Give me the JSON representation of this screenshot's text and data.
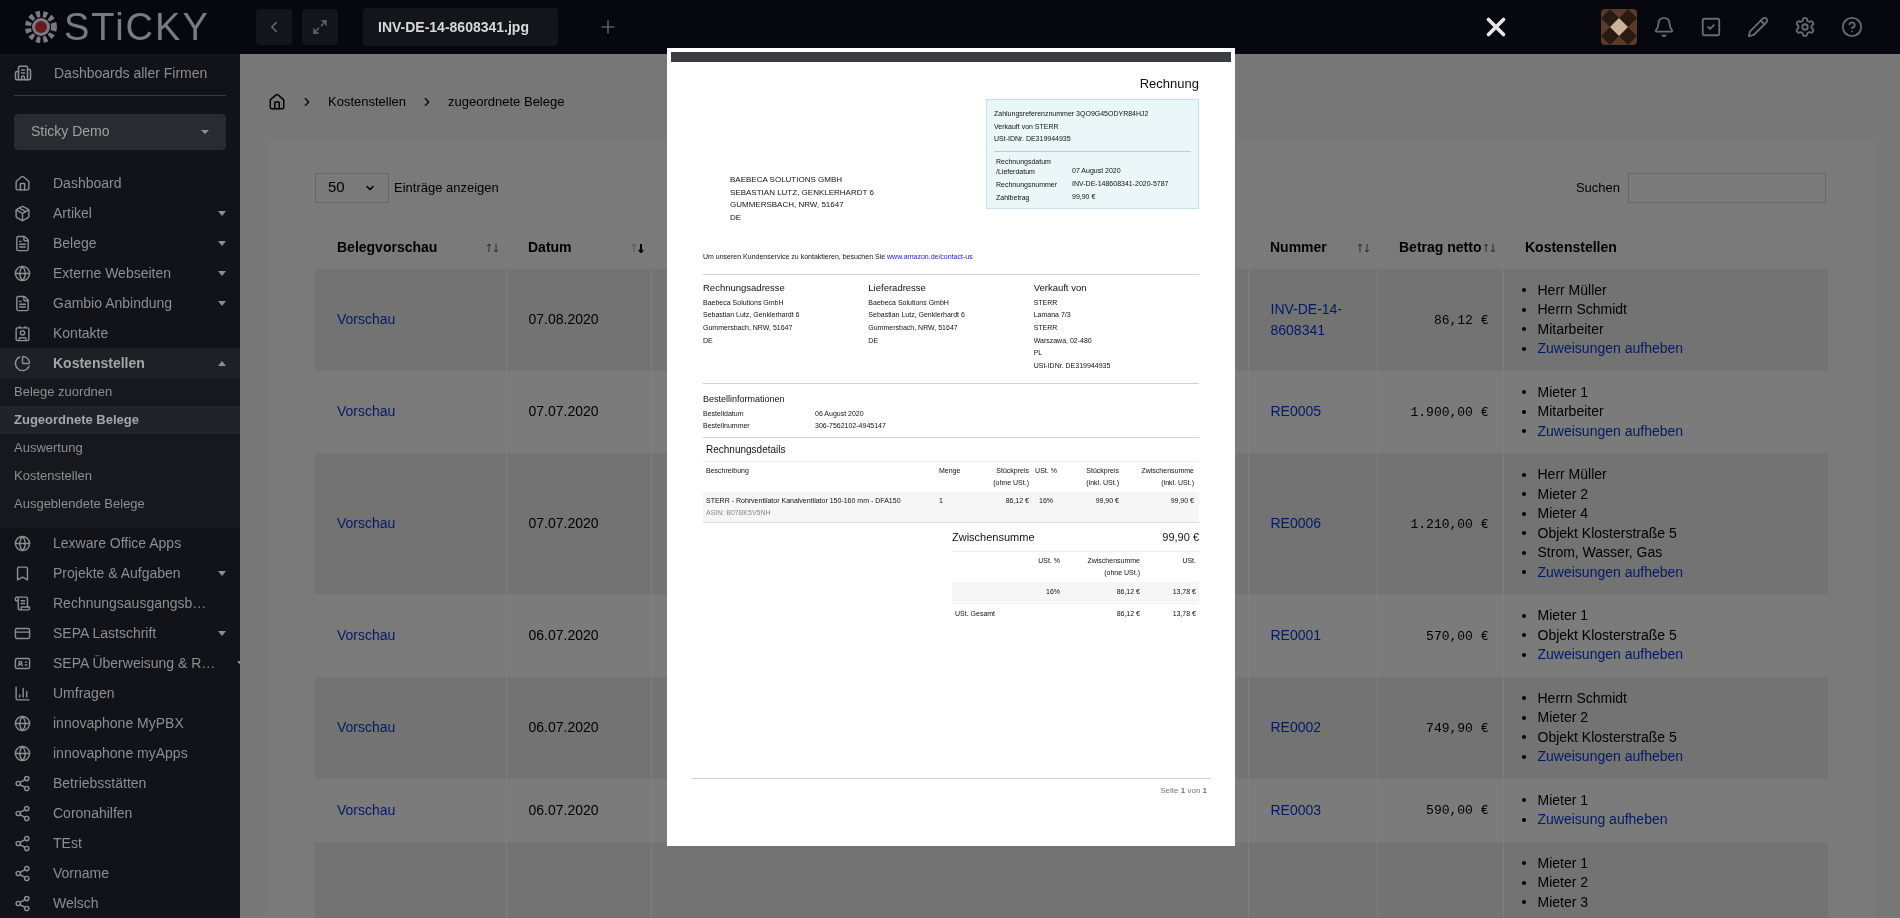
{
  "top_bar": {
    "logo": "STiCKY",
    "file_tab": "INV-DE-14-8608341.jpg"
  },
  "sidebar": {
    "top_link": "Dashboards aller Firmen",
    "company_select": "Sticky Demo",
    "items": [
      {
        "label": "Dashboard",
        "expandable": false,
        "expanded": false,
        "selected": false
      },
      {
        "label": "Artikel",
        "expandable": true,
        "expanded": false,
        "selected": false
      },
      {
        "label": "Belege",
        "expandable": true,
        "expanded": false,
        "selected": false
      },
      {
        "label": "Externe Webseiten",
        "expandable": true,
        "expanded": false,
        "selected": false
      },
      {
        "label": "Gambio Anbindung",
        "expandable": true,
        "expanded": false,
        "selected": false
      },
      {
        "label": "Kontakte",
        "expandable": false,
        "expanded": false,
        "selected": false
      },
      {
        "label": "Kostenstellen",
        "expandable": true,
        "expanded": true,
        "selected": true,
        "children": [
          {
            "label": "Belege zuordnen",
            "selected": false
          },
          {
            "label": "Zugeordnete Belege",
            "selected": true
          },
          {
            "label": "Auswertung",
            "selected": false
          },
          {
            "label": "Kostenstellen",
            "selected": false
          },
          {
            "label": "Ausgeblendete Belege",
            "selected": false
          }
        ]
      },
      {
        "label": "Lexware Office Apps",
        "expandable": false,
        "expanded": false,
        "selected": false
      },
      {
        "label": "Projekte & Aufgaben",
        "expandable": true,
        "expanded": false,
        "selected": false
      },
      {
        "label": "Rechnungsausgangsb…",
        "expandable": false,
        "expanded": false,
        "selected": false
      },
      {
        "label": "SEPA Lastschrift",
        "expandable": true,
        "expanded": false,
        "selected": false
      },
      {
        "label": "SEPA Überweisung & R…",
        "expandable": true,
        "expanded": false,
        "selected": false
      },
      {
        "label": "Umfragen",
        "expandable": false,
        "expanded": false,
        "selected": false
      },
      {
        "label": "innovaphone MyPBX",
        "expandable": false,
        "expanded": false,
        "selected": false
      },
      {
        "label": "innovaphone myApps",
        "expandable": false,
        "expanded": false,
        "selected": false
      },
      {
        "label": "Betriebsstätten",
        "expandable": false,
        "expanded": false,
        "selected": false
      },
      {
        "label": "Coronahilfen",
        "expandable": false,
        "expanded": false,
        "selected": false
      },
      {
        "label": "TEst",
        "expandable": false,
        "expanded": false,
        "selected": false
      },
      {
        "label": "Vorname",
        "expandable": false,
        "expanded": false,
        "selected": false
      },
      {
        "label": "Welsch",
        "expandable": false,
        "expanded": false,
        "selected": false
      }
    ]
  },
  "breadcrumb": [
    "Kostenstellen",
    "zugeordnete Belege"
  ],
  "table_controls": {
    "page_size": "50",
    "page_size_label": "Einträge anzeigen",
    "search_label": "Suchen"
  },
  "table": {
    "columns": [
      {
        "label": "Belegvorschau",
        "sortable": true,
        "sorted_desc": false
      },
      {
        "label": "Datum",
        "sortable": true,
        "sorted_desc": true
      },
      {
        "label": "Nummer",
        "sortable": true,
        "sorted_desc": false
      },
      {
        "label": "Betrag netto",
        "sortable": true,
        "sorted_desc": false
      },
      {
        "label": "Kostenstellen",
        "sortable": false
      }
    ],
    "rows": [
      {
        "preview": "Vorschau",
        "date": "07.08.2020",
        "number": "INV-DE-14-8608341",
        "amount": "86,12 €",
        "cost_centers": [
          "Herr Müller",
          "Herrn Schmidt",
          "Mitarbeiter"
        ],
        "action": "Zuweisungen aufheben"
      },
      {
        "preview": "Vorschau",
        "date": "07.07.2020",
        "number": "RE0005",
        "amount": "1.900,00 €",
        "cost_centers": [
          "Mieter 1",
          "Mitarbeiter"
        ],
        "action": "Zuweisungen aufheben"
      },
      {
        "preview": "Vorschau",
        "date": "07.07.2020",
        "number": "RE0006",
        "amount": "1.210,00 €",
        "cost_centers": [
          "Herr Müller",
          "Mieter 2",
          "Mieter 4",
          "Objekt Klosterstraße 5",
          "Strom, Wasser, Gas"
        ],
        "action": "Zuweisungen aufheben"
      },
      {
        "preview": "Vorschau",
        "date": "06.07.2020",
        "number": "RE0001",
        "amount": "570,00 €",
        "cost_centers": [
          "Mieter 1",
          "Objekt Klosterstraße 5"
        ],
        "action": "Zuweisungen aufheben"
      },
      {
        "preview": "Vorschau",
        "date": "06.07.2020",
        "number": "RE0002",
        "amount": "749,90 €",
        "cost_centers": [
          "Herrn Schmidt",
          "Mieter 2",
          "Objekt Klosterstraße 5"
        ],
        "action": "Zuweisungen aufheben"
      },
      {
        "preview": "Vorschau",
        "date": "06.07.2020",
        "number": "RE0003",
        "amount": "590,00 €",
        "cost_centers": [
          "Mieter 1"
        ],
        "action": "Zuweisung aufheben"
      },
      {
        "cost_centers": [
          "Mieter 1",
          "Mieter 2",
          "Mieter 3"
        ]
      }
    ]
  },
  "document": {
    "title": "Rechnung",
    "info_lines": [
      "Zahlungsreferenznummer 3QO9G45ODYR84HJ2",
      "Verkauft von STERR",
      "USt-IDNr. DE319944935"
    ],
    "info_fields": [
      {
        "label": "Rechnungsdatum /Lieferdatum",
        "value": "07 August 2020"
      },
      {
        "label": "Rechnungsnummer",
        "value": "INV-DE-148608341-2020-5787"
      },
      {
        "label": "Zahlbetrag",
        "value": "99,90 €"
      }
    ],
    "recipient": [
      "BAEBECA SOLUTIONS GMBH",
      "SEBASTIAN LUTZ, GENKLERHARDT 6",
      "GUMMERSBACH, NRW, 51647",
      "DE"
    ],
    "contact_text": "Um unseren Kundenservice zu kontaktieren, besuchen Sie",
    "contact_link": "www.amazon.de/contact-us",
    "addresses": [
      {
        "heading": "Rechnungsadresse",
        "lines": [
          "Baebeca Solutions GmbH",
          "Sebastian Lutz, Genklerhardt 6",
          "Gummersbach, NRW, 51647",
          "DE"
        ]
      },
      {
        "heading": "Lieferadresse",
        "lines": [
          "Baebeca Solutions GmbH",
          "Sebastian Lutz, Genklerhardt 6",
          "Gummersbach, NRW, 51647",
          "DE"
        ]
      },
      {
        "heading": "Verkauft von",
        "lines": [
          "STERR",
          "Lamana 7/3",
          "STERR",
          "Warszawa, 02-480",
          "PL",
          "USt-IDNr. DE319944935"
        ]
      }
    ],
    "order_heading": "Bestellinformationen",
    "order_rows": [
      {
        "label": "Bestelldatum",
        "value": "06 August 2020"
      },
      {
        "label": "Bestellnummer",
        "value": "306-7562102-4945147"
      }
    ],
    "details_heading": "Rechnungsdetails",
    "details_columns": [
      "Beschreibung",
      "Menge",
      "Stückpreis\n(ohne USt.)",
      "USt. %",
      "Stückpreis\n(inkl. USt.)",
      "Zwischensumme\n(inkl. USt.)"
    ],
    "items": [
      {
        "description": "STERR - Rohrventilator Kanalventilator 150-160 mm - DFA150",
        "asin": "ASIN: B07BK5V5NH",
        "quantity": "1",
        "unit_net": "86,12 €",
        "vat": "16%",
        "unit_gross": "99,90 €",
        "subtotal": "99,90 €"
      }
    ],
    "subtotal_label": "Zwischensumme",
    "subtotal_value": "99,90 €",
    "vat_columns": [
      "USt. %",
      "Zwischensumme\n(ohne USt.)",
      "USt."
    ],
    "vat_rows": [
      [
        "16%",
        "86,12 €",
        "13,78 €"
      ]
    ],
    "vat_total": [
      "USt. Gesamt",
      "86,12 €",
      "13,78 €"
    ],
    "footer": "Seite **1** von **1**"
  }
}
